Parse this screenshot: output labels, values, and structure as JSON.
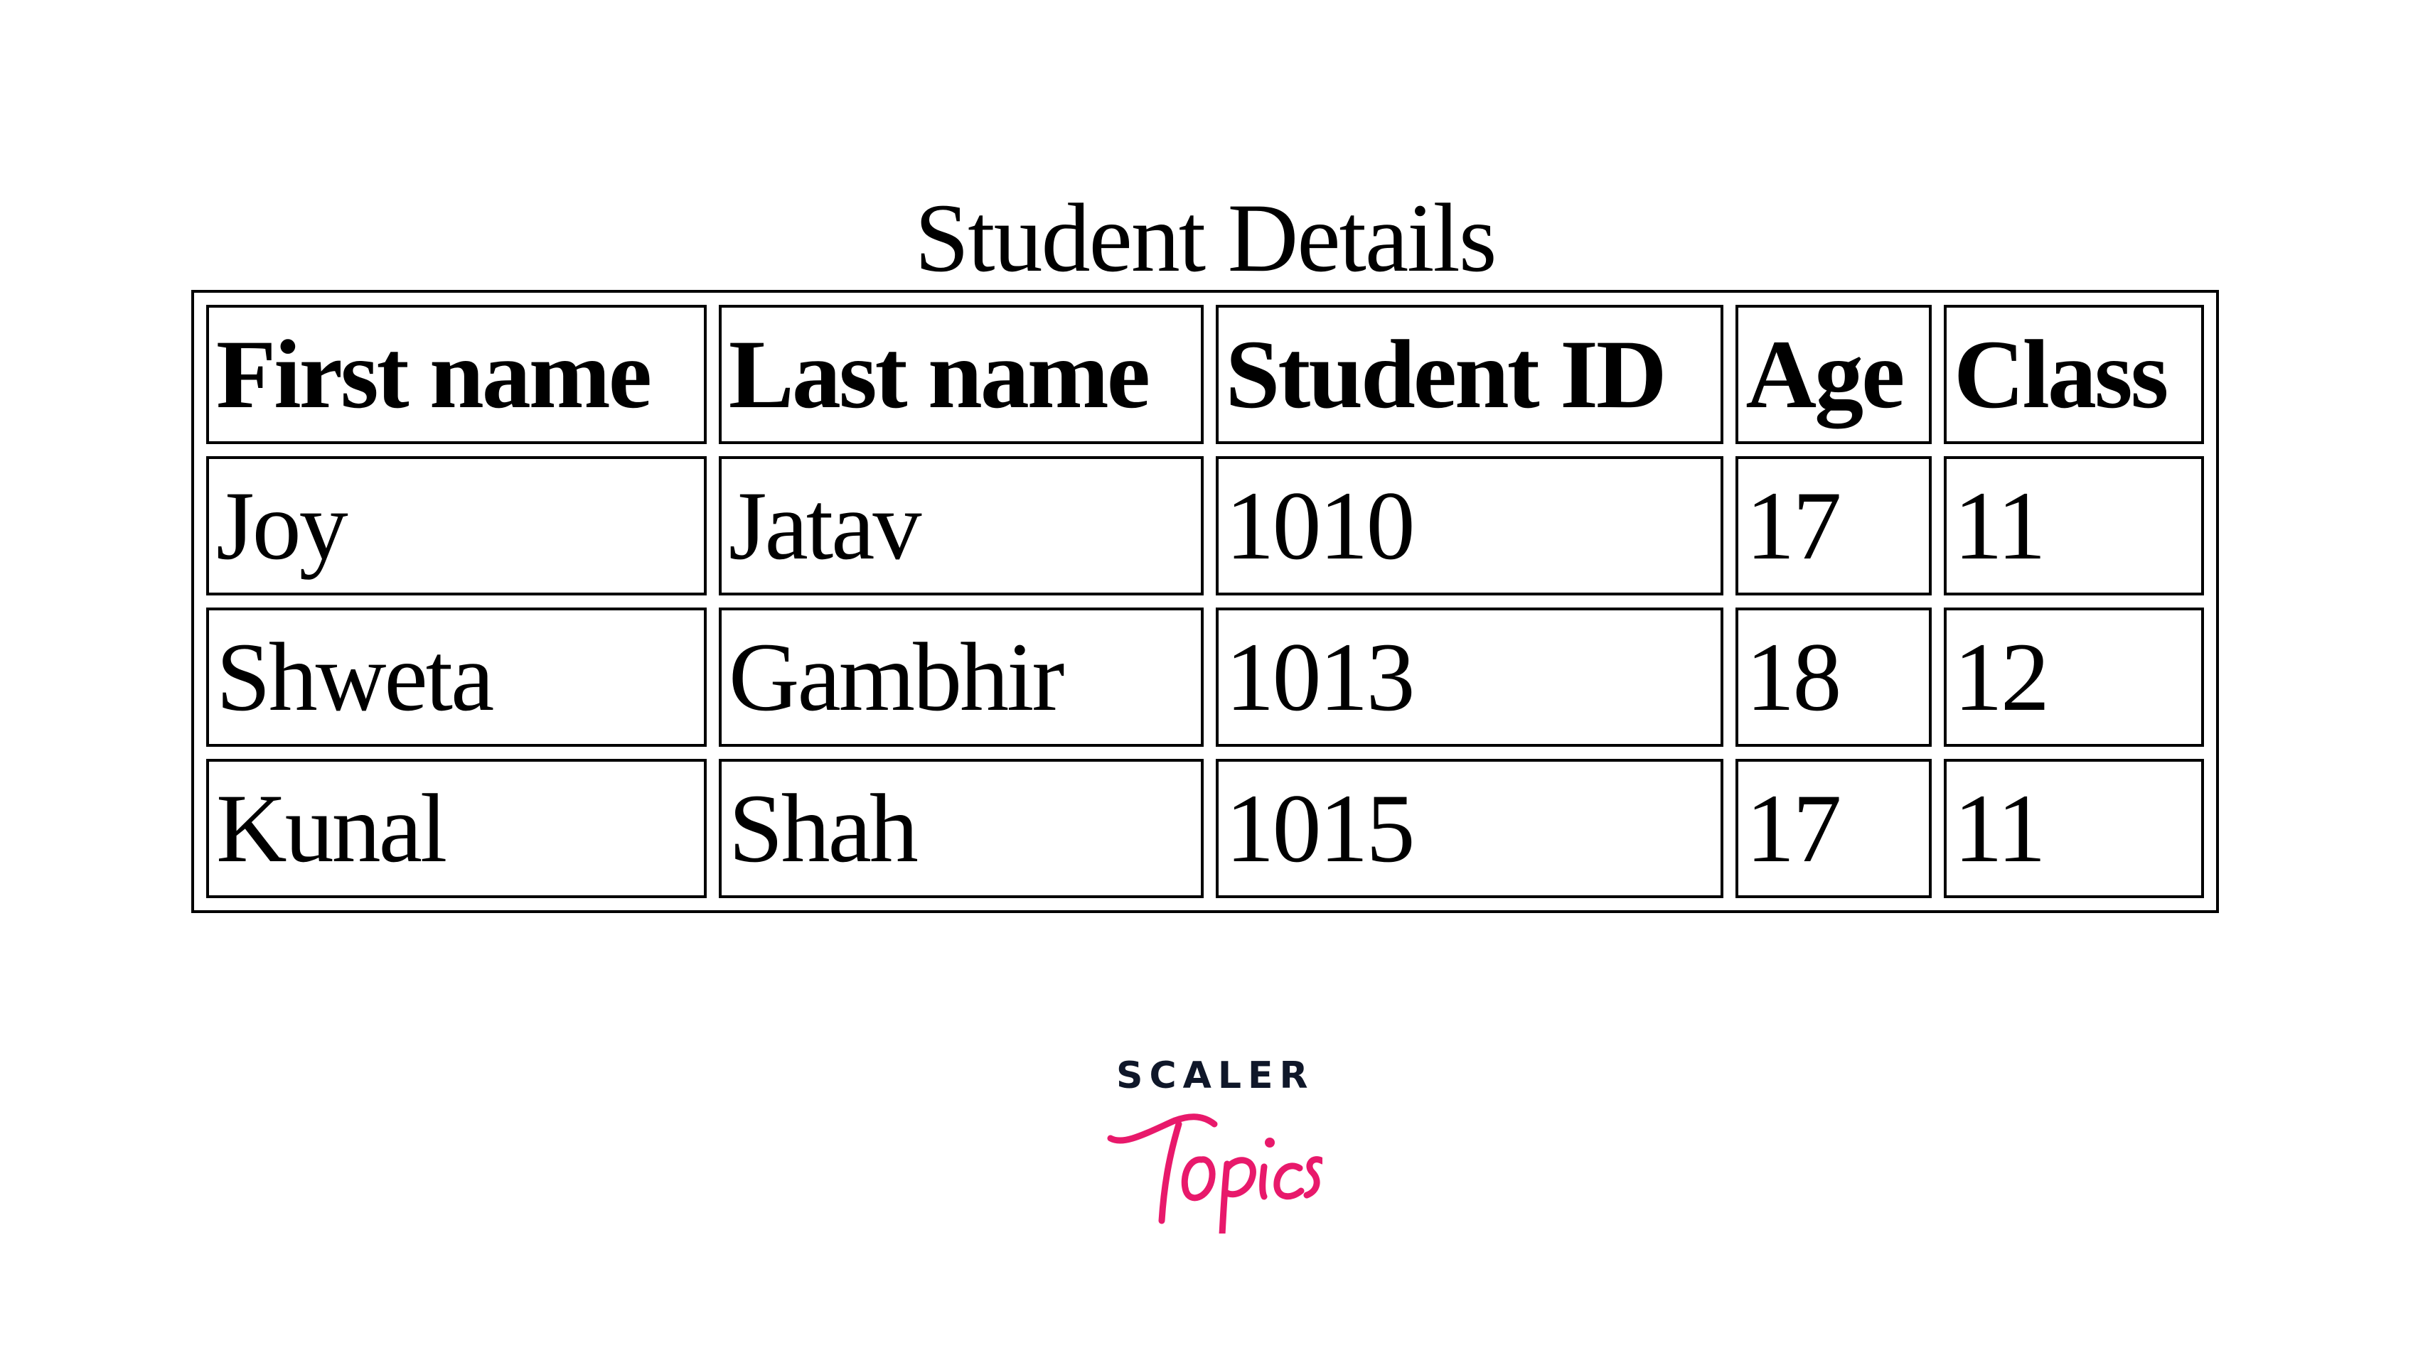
{
  "table": {
    "caption": "Student Details",
    "headers": [
      "First name",
      "Last name",
      "Student ID",
      "Age",
      "Class"
    ],
    "rows": [
      [
        "Joy",
        "Jatav",
        "1010",
        "17",
        "11"
      ],
      [
        "Shweta",
        "Gambhir",
        "1013",
        "18",
        "12"
      ],
      [
        "Kunal",
        "Shah",
        "1015",
        "17",
        "11"
      ]
    ]
  },
  "logo": {
    "brand": "SCALER",
    "sub": "Topics",
    "brand_color": "#0f1729",
    "accent_color": "#e8196b"
  }
}
